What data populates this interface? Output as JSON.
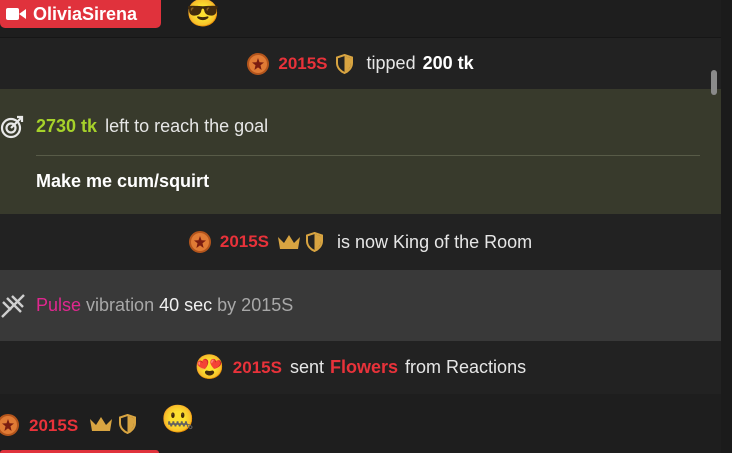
{
  "header": {
    "model_name": "OliviaSirena",
    "emoji": "😎"
  },
  "feed": {
    "tip": {
      "username": "2015S",
      "action": "tipped",
      "amount": "200 tk"
    },
    "goal": {
      "amount": "2730 tk",
      "text": "left to reach the goal",
      "title": "Make me cum/squirt"
    },
    "king": {
      "username": "2015S",
      "text": "is now King of the Room"
    },
    "vibration": {
      "brand": "Pulse",
      "word": "vibration",
      "duration": "40 sec",
      "by": "by 2015S"
    },
    "reaction": {
      "emoji": "😍",
      "username": "2015S",
      "sent": "sent",
      "item": "Flowers",
      "from": "from Reactions"
    },
    "last_message": {
      "username": "2015S",
      "emoji": "🤐"
    }
  },
  "colors": {
    "accent_red": "#e8323a",
    "goal_green": "#a6d22a",
    "pulse_pink": "#e0278f",
    "goal_bg": "#383a2c",
    "crown_gold": "#d8a441"
  }
}
